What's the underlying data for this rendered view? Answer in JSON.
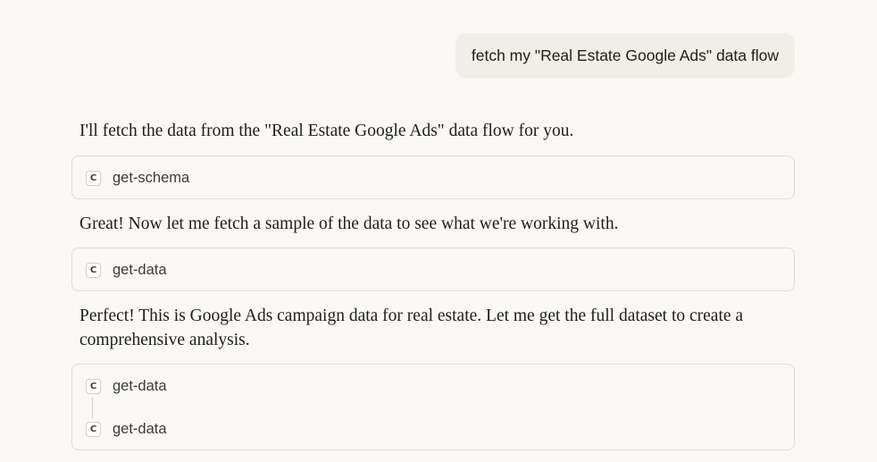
{
  "conversation": {
    "user_message": "fetch my \"Real Estate Google Ads\" data flow",
    "assistant_messages": [
      "I'll fetch the data from the \"Real Estate Google Ads\" data flow for you.",
      "Great! Now let me fetch a sample of the data to see what we're working with.",
      "Perfect! This is Google Ads campaign data for real estate. Let me get the full dataset to create a comprehensive analysis."
    ],
    "tool_blocks": [
      {
        "calls": [
          {
            "icon": "C",
            "label": "get-schema"
          }
        ]
      },
      {
        "calls": [
          {
            "icon": "C",
            "label": "get-data"
          }
        ]
      },
      {
        "calls": [
          {
            "icon": "C",
            "label": "get-data"
          },
          {
            "icon": "C",
            "label": "get-data"
          }
        ]
      }
    ]
  },
  "icons": {
    "tool": "tool-call-icon"
  }
}
